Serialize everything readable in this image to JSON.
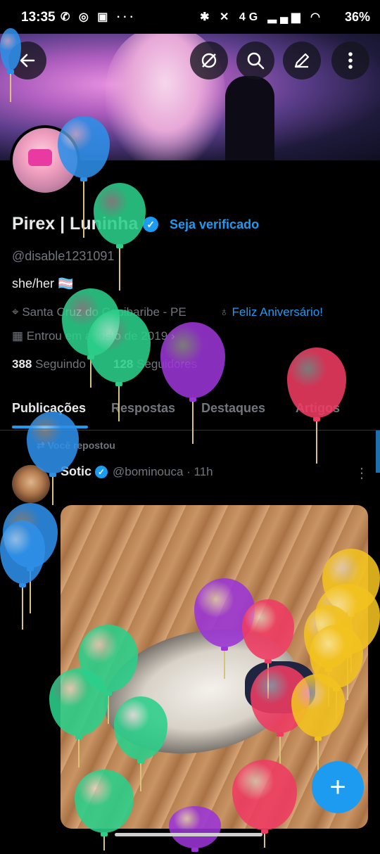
{
  "status_bar": {
    "time": "13:35",
    "left_icons": "✆ ◎ ▣ ···",
    "right_icons": "✱ ✕ 4G ▂▄▆ ◠",
    "battery": "36%"
  },
  "header": {
    "back_icon": "arrow-left-icon",
    "buttons": [
      "no-sync-icon",
      "search-icon",
      "edit-icon",
      "more-vertical-icon"
    ]
  },
  "profile": {
    "name": "Pirex | Luninha",
    "verified_icon": "✓",
    "get_verified": "Seja verificado",
    "handle": "@disable1231091",
    "bio": "she/her 🏳️‍⚧️",
    "location": "Santa Cruz do Capibaribe - PE",
    "birthday": "Feliz Aniversário!",
    "joined": "Entrou em agosto de 2019",
    "following_count": "388",
    "following_label": "Seguindo",
    "followers_count": "128",
    "followers_label": "Seguidores"
  },
  "tabs": [
    {
      "label": "Publicações",
      "active": true
    },
    {
      "label": "Respostas",
      "active": false
    },
    {
      "label": "Destaques",
      "active": false
    },
    {
      "label": "Artigos",
      "active": false
    }
  ],
  "post": {
    "repost_label": "Você repostou",
    "author": "Sotic",
    "author_handle_time": "@bominouca · 11h",
    "more": "⋮"
  },
  "fab": {
    "icon": "+"
  },
  "colors": {
    "accent": "#1d9bf0",
    "background": "#000000",
    "muted": "#71767b"
  }
}
